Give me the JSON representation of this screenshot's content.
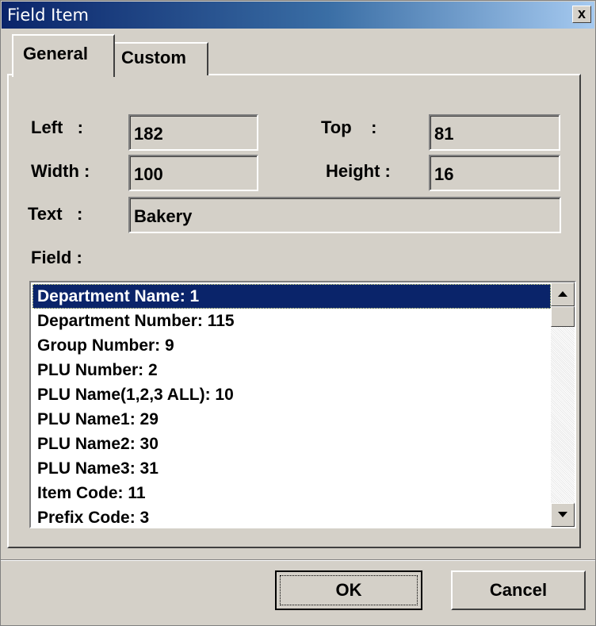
{
  "window": {
    "title": "Field Item",
    "close_label": "x"
  },
  "tabs": [
    {
      "label": "General",
      "active": true
    },
    {
      "label": "Custom",
      "active": false
    }
  ],
  "form": {
    "left_label": "Left   :",
    "left_value": "182",
    "top_label": "Top    :",
    "top_value": "81",
    "width_label": "Width :",
    "width_value": "100",
    "height_label": "Height :",
    "height_value": "16",
    "text_label": "Text   :",
    "text_value": "Bakery",
    "field_label": "Field :"
  },
  "field_list": {
    "selected_index": 0,
    "items": [
      "Department Name: 1",
      "Department Number: 115",
      "Group Number: 9",
      "PLU Number: 2",
      "PLU Name(1,2,3 ALL): 10",
      "PLU Name1: 29",
      "PLU Name2: 30",
      "PLU Name3: 31",
      "Item Code: 11",
      "Prefix Code: 3"
    ]
  },
  "buttons": {
    "ok": "OK",
    "cancel": "Cancel"
  },
  "colors": {
    "face": "#d4d0c8",
    "selection": "#0a246a",
    "title_start": "#0a246a",
    "title_end": "#a6caf0"
  }
}
